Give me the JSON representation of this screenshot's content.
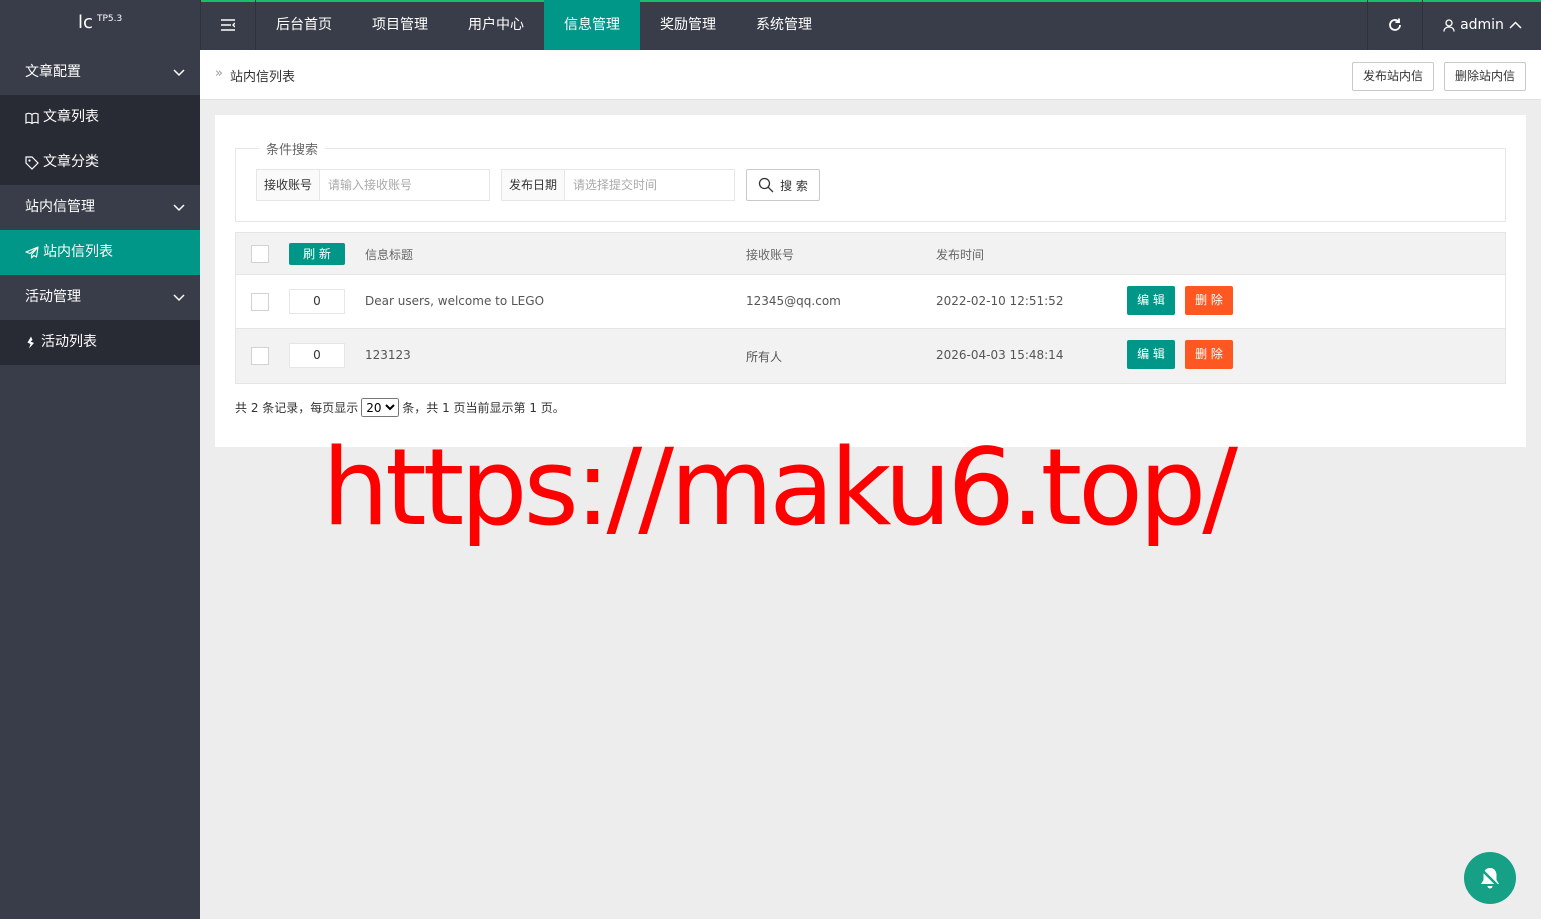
{
  "app": {
    "logo_text": "lc",
    "logo_version": "TP5.3"
  },
  "header": {
    "nav": [
      {
        "label": "后台首页",
        "active": false
      },
      {
        "label": "项目管理",
        "active": false
      },
      {
        "label": "用户中心",
        "active": false
      },
      {
        "label": "信息管理",
        "active": true
      },
      {
        "label": "奖励管理",
        "active": false
      },
      {
        "label": "系统管理",
        "active": false
      }
    ],
    "user_name": "admin",
    "accent_color": "#009688"
  },
  "sidebar": {
    "groups": [
      {
        "label": "文章配置",
        "items": [
          {
            "label": "文章列表",
            "icon": "book-icon"
          },
          {
            "label": "文章分类",
            "icon": "tag-icon"
          }
        ]
      },
      {
        "label": "站内信管理",
        "items": [
          {
            "label": "站内信列表",
            "icon": "paper-plane-icon",
            "active": true
          }
        ]
      },
      {
        "label": "活动管理",
        "items": [
          {
            "label": "活动列表",
            "icon": "activity-icon"
          }
        ]
      }
    ]
  },
  "breadcrumb": {
    "current": "站内信列表"
  },
  "actions": {
    "publish_label": "发布站内信",
    "delete_label": "删除站内信"
  },
  "search": {
    "legend": "条件搜索",
    "account_label": "接收账号",
    "account_placeholder": "请输入接收账号",
    "date_label": "发布日期",
    "date_placeholder": "请选择提交时间",
    "button_label": "搜 索"
  },
  "table": {
    "refresh_label": "刷 新",
    "headers": {
      "title": "信息标题",
      "account": "接收账号",
      "time": "发布时间"
    },
    "rows": [
      {
        "sort": "0",
        "title": "Dear users, welcome to LEGO",
        "account": "12345@qq.com",
        "time": "2022-02-10 12:51:52",
        "edit": "编 辑",
        "delete": "删 除"
      },
      {
        "sort": "0",
        "title": "123123",
        "account": "所有人",
        "time": "2026-04-03 15:48:14",
        "edit": "编 辑",
        "delete": "删 除"
      }
    ]
  },
  "pager": {
    "prefix": "共 2 条记录，每页显示",
    "page_size": "20",
    "suffix": "条，共 1 页当前显示第 1 页。"
  },
  "watermark": "https://maku6.top/"
}
